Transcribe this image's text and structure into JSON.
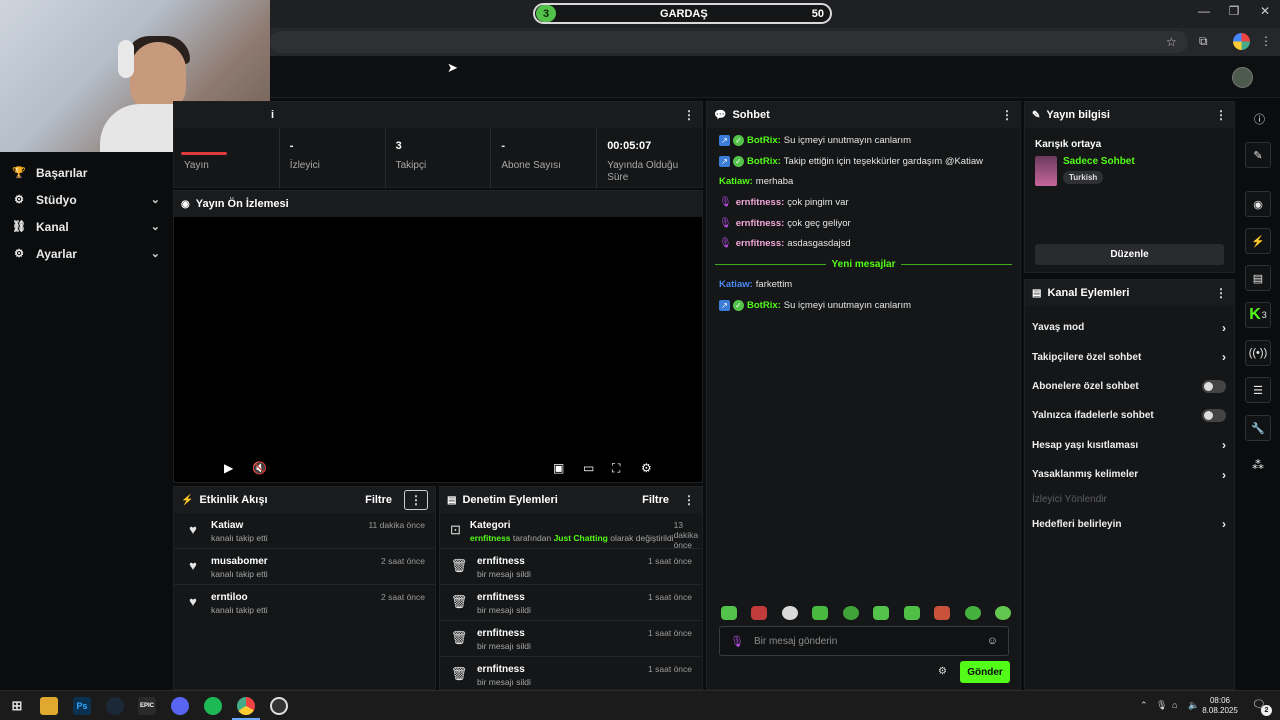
{
  "top_pill": {
    "level": "3",
    "name": "GARDAŞ",
    "points": "50"
  },
  "sidebar": {
    "items": [
      {
        "label": "Başarılar",
        "icon": "trophy-icon",
        "chevron": false
      },
      {
        "label": "Stüdyo",
        "icon": "studio-icon",
        "chevron": true
      },
      {
        "label": "Kanal",
        "icon": "channel-icon",
        "chevron": true
      },
      {
        "label": "Ayarlar",
        "icon": "gear-icon",
        "chevron": true
      }
    ]
  },
  "stats_panel": {
    "title_fragment": "i",
    "stats": [
      {
        "value": "",
        "label": "Yayın"
      },
      {
        "value": "-",
        "label": "İzleyici"
      },
      {
        "value": "3",
        "label": "Takipçi"
      },
      {
        "value": "-",
        "label": "Abone Sayısı"
      },
      {
        "value": "00:05:07",
        "label": "Yayında Olduğu Süre"
      }
    ]
  },
  "preview": {
    "title": "Yayın Ön İzlemesi"
  },
  "activity_feed": {
    "title": "Etkinlik Akışı",
    "filter_label": "Filtre",
    "items": [
      {
        "name": "Katiaw",
        "sub": "kanalı takip etti",
        "time": "11 dakika önce"
      },
      {
        "name": "musabomer",
        "sub": "kanalı takip etti",
        "time": "2 saat önce"
      },
      {
        "name": "erntiloo",
        "sub": "kanalı takip etti",
        "time": "2 saat önce"
      }
    ]
  },
  "mod_actions": {
    "title": "Denetim Eylemleri",
    "filter_label": "Filtre",
    "category": {
      "name": "Kategori",
      "time": "13 dakika önce",
      "user": "ernfitness",
      "by": "tarafından",
      "target": "Just Chatting",
      "rest": "olarak değiştirildi"
    },
    "items": [
      {
        "name": "ernfitness",
        "sub": "bir mesajı sildi",
        "time": "1 saat önce"
      },
      {
        "name": "ernfitness",
        "sub": "bir mesajı sildi",
        "time": "1 saat önce"
      },
      {
        "name": "ernfitness",
        "sub": "bir mesajı sildi",
        "time": "1 saat önce"
      },
      {
        "name": "ernfitness",
        "sub": "bir mesajı sildi",
        "time": "1 saat önce"
      }
    ]
  },
  "chat": {
    "title": "Sohbet",
    "messages": [
      {
        "user": "BotRix:",
        "text": "Su içmeyi unutmayın canlarım",
        "badges": "bot"
      },
      {
        "user": "BotRix:",
        "text": "Takip ettiğin için teşekkürler gardaşım @Katiaw",
        "badges": "bot"
      },
      {
        "user": "Katiaw:",
        "text": "merhaba",
        "badges": "none"
      },
      {
        "user": "ernfitness:",
        "text": "çok pingim var",
        "badges": "mic"
      },
      {
        "user": "ernfitness:",
        "text": "çok geç geliyor",
        "badges": "mic"
      },
      {
        "user": "ernfitness:",
        "text": "asdasgasdajsd",
        "badges": "mic"
      }
    ],
    "new_messages_label": "Yeni mesajlar",
    "after": [
      {
        "user": "Katiaw:",
        "text": "farkettim",
        "badges": "blue"
      },
      {
        "user": "BotRix:",
        "text": "Su içmeyi unutmayın canlarım",
        "badges": "bot"
      }
    ],
    "input_placeholder": "Bir mesaj gönderin",
    "send_label": "Gönder"
  },
  "stream_info": {
    "title": "Yayın bilgisi",
    "stream_title": "Karışık ortaya",
    "category": "Sadece Sohbet",
    "tag": "Turkish",
    "edit_label": "Düzenle"
  },
  "channel_actions": {
    "title": "Kanal Eylemleri",
    "items": [
      {
        "label": "Yavaş mod",
        "control": "chevron"
      },
      {
        "label": "Takipçilere özel sohbet",
        "control": "chevron"
      },
      {
        "label": "Abonelere özel sohbet",
        "control": "toggle"
      },
      {
        "label": "Yalnızca ifadelerle sohbet",
        "control": "toggle"
      },
      {
        "label": "Hesap yaşı kısıtlaması",
        "control": "chevron"
      },
      {
        "label": "Yasaklanmış kelimeler",
        "control": "chevron"
      },
      {
        "label": "İzleyici Yönlendir",
        "control": "disabled"
      },
      {
        "label": "Hedefleri belirleyin",
        "control": "chevron"
      }
    ]
  },
  "rail_badge": "3",
  "taskbar": {
    "time": "08:06",
    "date": "8.08.2025",
    "notif_count": "2",
    "app_labels": [
      "Ps",
      "EPIC"
    ]
  },
  "colors": {
    "accent": "#53fc18",
    "bg": "#0b0c0d",
    "panel": "#151617"
  }
}
